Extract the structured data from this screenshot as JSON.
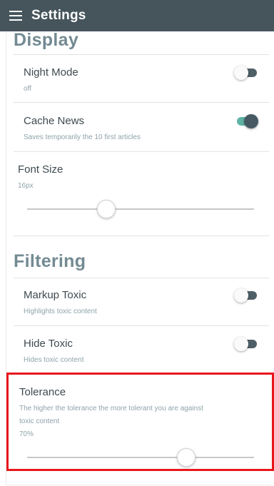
{
  "app_bar": {
    "title": "Settings",
    "menu_icon": "hamburger-menu-icon"
  },
  "display": {
    "title": "Display",
    "night_mode": {
      "label": "Night Mode",
      "value": "off",
      "enabled": false
    },
    "cache_news": {
      "label": "Cache News",
      "description": "Saves temporarily the 10 first articles",
      "enabled": true
    },
    "font_size": {
      "label": "Font Size",
      "value": "16px",
      "slider_level": 0.35
    }
  },
  "filtering": {
    "title": "Filtering",
    "markup_toxic": {
      "label": "Markup Toxic",
      "description": "Highlights toxic content",
      "enabled": false
    },
    "hide_toxic": {
      "label": "Hide Toxic",
      "description": "Hides toxic content",
      "enabled": false
    },
    "tolerance": {
      "label": "Tolerance",
      "description_line1": "The higher the tolerance the more tolerant you are against",
      "description_line2": "toxic content",
      "value": "70%",
      "slider_level": 0.7
    }
  },
  "colors": {
    "app_bar": "#46555c",
    "section_title": "#738a92",
    "toggle_on": "#5fb3a5",
    "highlight": "#e8161b"
  }
}
